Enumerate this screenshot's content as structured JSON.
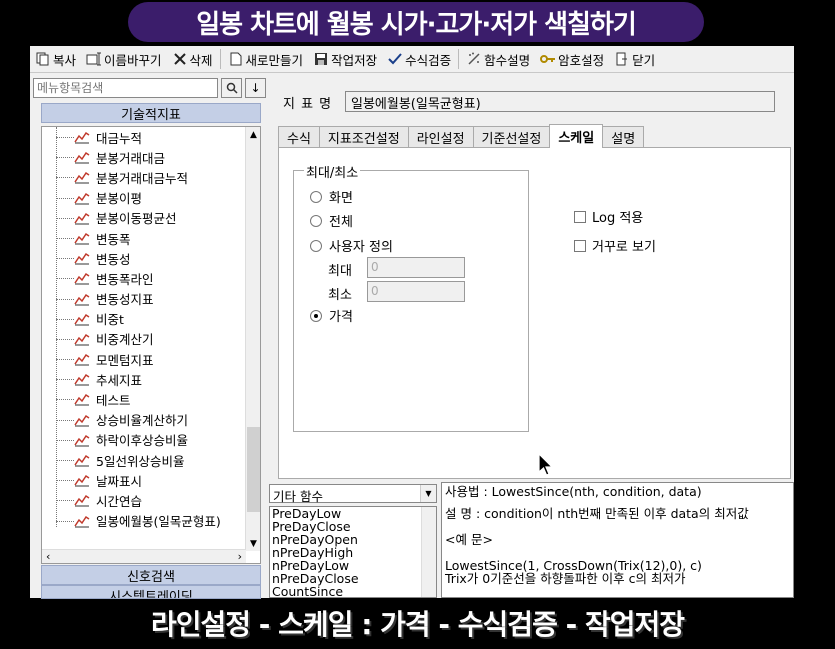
{
  "caption": {
    "top": "일봉 차트에 월봉 시가·고가·저가 색칠하기",
    "bottom": "라인설정 - 스케일 : 가격 - 수식검증 - 작업저장"
  },
  "toolbar": {
    "items": [
      {
        "label": "복사",
        "icon": "copy-icon"
      },
      {
        "label": "이름바꾸기",
        "icon": "rename-icon"
      },
      {
        "label": "삭제",
        "icon": "delete-icon"
      },
      {
        "label": "새로만들기",
        "icon": "new-icon"
      },
      {
        "label": "작업저장",
        "icon": "save-icon"
      },
      {
        "label": "수식검증",
        "icon": "check-icon"
      },
      {
        "label": "함수설명",
        "icon": "function-help-icon"
      },
      {
        "label": "암호설정",
        "icon": "key-icon"
      },
      {
        "label": "닫기",
        "icon": "close-icon"
      }
    ]
  },
  "sidebar": {
    "search_placeholder": "메뉴항목검색",
    "category_top": "기술적지표",
    "items": [
      "대금누적",
      "분봉거래대금",
      "분봉거래대금누적",
      "분봉이평",
      "분봉이동평균선",
      "변동폭",
      "변동성",
      "변동폭라인",
      "변동성지표",
      "비중t",
      "비중계산기",
      "모멘텀지표",
      "추세지표",
      "테스트",
      "상승비율계산하기",
      "하락이후상승비율",
      "5일선위상승비율",
      "날짜표시",
      "시간연습",
      "일봉에월봉(일목균형표)"
    ],
    "category_signal": "신호검색",
    "category_system": "시스템트레이딩"
  },
  "form": {
    "name_label": "지 표 명",
    "name_value": "일봉에월봉(일목균형표)",
    "tabs": [
      "수식",
      "지표조건설정",
      "라인설정",
      "기준선설정",
      "스케일",
      "설명"
    ],
    "active_tab": "스케일",
    "group_title": "최대/최소",
    "radios": [
      "화면",
      "전체",
      "사용자 정의",
      "가격"
    ],
    "selected_radio": "가격",
    "max_label": "최대",
    "max_value": "0",
    "min_label": "최소",
    "min_value": "0",
    "log_label": "Log 적용",
    "reverse_label": "거꾸로 보기"
  },
  "functions": {
    "category": "기타 함수",
    "list": [
      "PreDayLow",
      "PreDayClose",
      "nPreDayOpen",
      "nPreDayHigh",
      "nPreDayLow",
      "nPreDayClose",
      "CountSince"
    ],
    "help_usage": "사용법 : LowestSince(nth, condition, data)",
    "help_desc": "설    명 : condition이 nth번째 만족된 이후 data의 최저값",
    "help_example_title": "<예 문>",
    "help_example_1": "LowestSince(1, CrossDown(Trix(12),0), c)",
    "help_example_2": "Trix가 0기준선을 하향돌파한 이후 c의 최저가"
  }
}
